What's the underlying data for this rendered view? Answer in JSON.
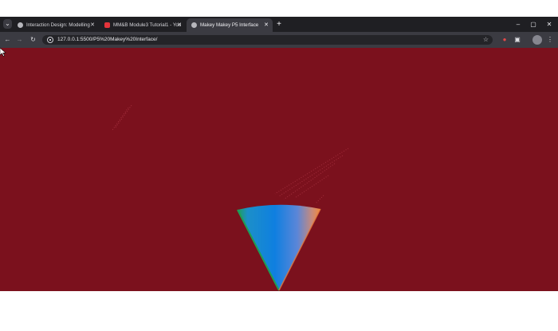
{
  "tabs": [
    {
      "title": "Interaction Design: Modelling",
      "active": false,
      "favicon_color": "#b7b7bd"
    },
    {
      "title": "MM&B Module3 Tutorial1 - You",
      "active": false,
      "favicon_color": "#e3343b"
    },
    {
      "title": "Makey Makey P5 Interface",
      "active": true,
      "favicon_color": "#b7b7bd"
    }
  ],
  "window_controls": {
    "minimize": "–",
    "maximize": "▢",
    "close": "✕"
  },
  "toolbar": {
    "back": "←",
    "forward": "→",
    "reload": "↻",
    "url": "127.0.0.1:5500/P5%20Makey%20Interface/",
    "bookmark": "☆"
  },
  "extensions": [
    {
      "name": "record-icon",
      "glyph": "●"
    },
    {
      "name": "extensions-icon",
      "glyph": "▣"
    },
    {
      "name": "profile-avatar-icon",
      "glyph": "●"
    },
    {
      "name": "menu-icon",
      "glyph": "⋮"
    }
  ],
  "colors": {
    "canvas_background": "#7b111d",
    "cone_left": "#1f9e55",
    "cone_center": "#0f7fe0",
    "cone_right": "#f28a3a"
  }
}
